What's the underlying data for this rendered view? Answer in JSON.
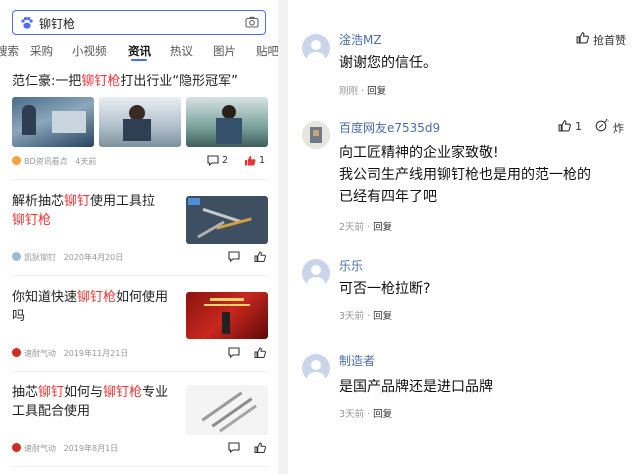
{
  "search": {
    "query": "铆钉枪"
  },
  "tabs": [
    "搜索",
    "采购",
    "小视频",
    "资讯",
    "热议",
    "图片",
    "贴吧"
  ],
  "articles": [
    {
      "title_parts": [
        "范仁豪:一把",
        "铆钉枪",
        "打出行业“隐形冠军”"
      ],
      "source": "BD资讯看点",
      "time": "4天前",
      "comments": "2",
      "likes": "1"
    },
    {
      "title_parts": [
        "解析抽芯",
        "铆钉",
        "使用工具拉",
        "铆钉枪"
      ],
      "source": "凯狄铆钉",
      "time": "2020年4月20日"
    },
    {
      "title_parts": [
        "你知道快速",
        "铆钉枪",
        "如何使用吗"
      ],
      "source": "速耐气动",
      "time": "2019年11月21日"
    },
    {
      "title_parts": [
        "抽芯",
        "铆钉",
        "如何与",
        "铆钉枪",
        "专业工具配合使用"
      ],
      "source": "速耐气动",
      "time": "2019年8月1日"
    }
  ],
  "comments": [
    {
      "name": "淦浩MZ",
      "text": "谢谢您的信任。",
      "time": "刚刚",
      "reply": "回复",
      "action": "抢首赞"
    },
    {
      "name": "百度网友e7535d9",
      "text_lines": [
        "向工匠精神的企业家致敬!",
        "我公司生产线用铆钉枪也是用的范一枪的",
        "已经有四年了吧"
      ],
      "time": "2天前",
      "reply": "回复",
      "likes": "1",
      "action2": "炸"
    },
    {
      "name": "乐乐",
      "text": "可否一枪拉断?",
      "time": "3天前",
      "reply": "回复"
    },
    {
      "name": "制造者",
      "text": "是国产品牌还是进口品牌",
      "time": "3天前",
      "reply": "回复"
    }
  ],
  "colors": {
    "accent": "#4e6ef2",
    "highlight": "#ee3333",
    "username": "#4b6ea8"
  }
}
